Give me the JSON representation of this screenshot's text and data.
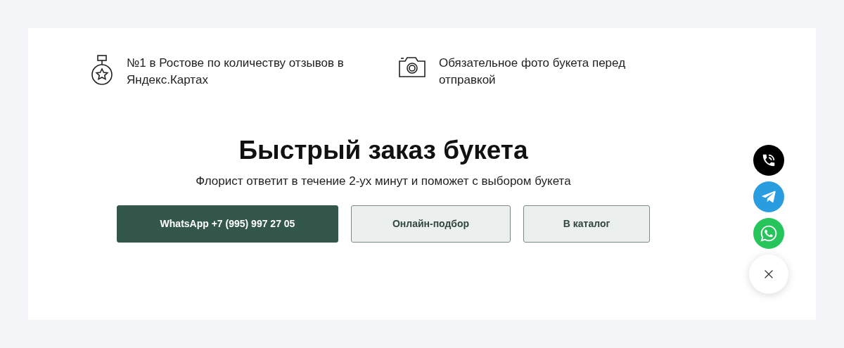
{
  "features": [
    {
      "kind": "medal",
      "text": "№1 в Ростове по количеству отзывов в Яндекс.Картах"
    },
    {
      "kind": "camera",
      "text": "Обязательное фото букета перед отправкой"
    }
  ],
  "title": "Быстрый заказ букета",
  "subtitle": "Флорист ответит в течение 2-ух минут и поможет с выбором букета",
  "buttons": [
    {
      "kind": "primary",
      "label": "WhatsApp +7 (995) 997 27 05"
    },
    {
      "kind": "secondary",
      "label": "Онлайн-подбор"
    },
    {
      "kind": "secondary",
      "label": "В каталог"
    }
  ],
  "floating_actions": [
    {
      "kind": "phone"
    },
    {
      "kind": "telegram"
    },
    {
      "kind": "whatsapp"
    },
    {
      "kind": "close"
    }
  ]
}
